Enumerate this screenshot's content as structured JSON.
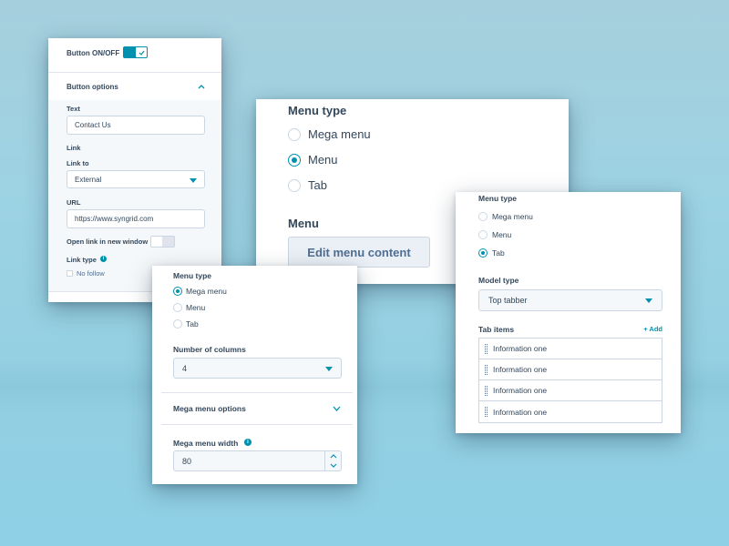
{
  "panel1": {
    "button_onoff_label": "Button ON/OFF",
    "button_options_label": "Button options",
    "text_label": "Text",
    "text_value": "Contact Us",
    "link_label": "Link",
    "link_to_label": "Link to",
    "link_to_value": "External",
    "url_label": "URL",
    "url_value": "https://www.syngrid.com",
    "open_new_window_label": "Open link in new window",
    "link_type_label": "Link type",
    "no_follow_label": "No follow"
  },
  "panel2": {
    "menu_type_label": "Menu type",
    "options": [
      "Mega menu",
      "Menu",
      "Tab"
    ],
    "selected": "Menu",
    "menu_label": "Menu",
    "edit_button_label": "Edit menu content"
  },
  "panel3": {
    "menu_type_label": "Menu type",
    "options": [
      "Mega menu",
      "Menu",
      "Tab"
    ],
    "selected": "Mega menu",
    "columns_label": "Number of columns",
    "columns_value": "4",
    "mega_options_label": "Mega menu options",
    "mega_width_label": "Mega menu width",
    "mega_width_value": "80"
  },
  "panel4": {
    "menu_type_label": "Menu type",
    "options": [
      "Mega menu",
      "Menu",
      "Tab"
    ],
    "selected": "Tab",
    "model_type_label": "Model type",
    "model_type_value": "Top tabber",
    "tab_items_label": "Tab items",
    "add_label": "+ Add",
    "tab_items": [
      "Information one",
      "Information one",
      "Information one",
      "Information one"
    ]
  },
  "colors": {
    "accent": "#0091ae",
    "text": "#33475b",
    "border": "#cbd6e2",
    "field_bg": "#f5f8fa"
  }
}
